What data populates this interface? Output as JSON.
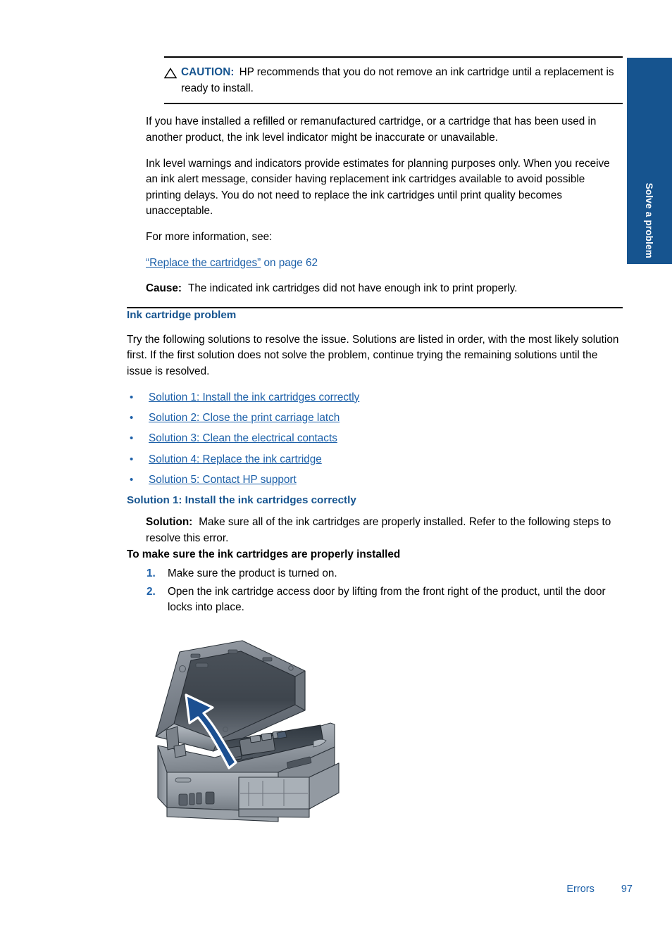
{
  "side_tab": {
    "label": "Solve a problem",
    "color": "#16548F"
  },
  "caution": {
    "icon": "caution-triangle-icon",
    "label": "CAUTION:",
    "text": "HP recommends that you do not remove an ink cartridge until a replacement is ready to install."
  },
  "paragraphs": {
    "refilled": "If you have installed a refilled or remanufactured cartridge, or a cartridge that has been used in another product, the ink level indicator might be inaccurate or unavailable.",
    "ink_level": "Ink level warnings and indicators provide estimates for planning purposes only. When you receive an ink alert message, consider having replacement ink cartridges available to avoid possible printing delays. You do not need to replace the ink cartridges until print quality becomes unacceptable.",
    "more_info": "For more information, see:"
  },
  "crossref": {
    "link_text": "“Replace the cartridges”",
    "suffix": " on page 62"
  },
  "cause": {
    "label": "Cause:",
    "text": "The indicated ink cartridges did not have enough ink to print properly."
  },
  "section": {
    "heading": "Ink cartridge problem",
    "intro": "Try the following solutions to resolve the issue. Solutions are listed in order, with the most likely solution first. If the first solution does not solve the problem, continue trying the remaining solutions until the issue is resolved.",
    "bullet_mark": "•",
    "solutions": [
      "Solution 1: Install the ink cartridges correctly",
      "Solution 2: Close the print carriage latch",
      "Solution 3: Clean the electrical contacts",
      "Solution 4: Replace the ink cartridge",
      "Solution 5: Contact HP support"
    ]
  },
  "solution_1": {
    "heading": "Solution 1: Install the ink cartridges correctly",
    "solution_label": "Solution:",
    "solution_text": "Make sure all of the ink cartridges are properly installed. Refer to the following steps to resolve this error.",
    "steps_title": "To make sure the ink cartridges are properly installed",
    "steps": [
      {
        "num": "1.",
        "text": "Make sure the product is turned on."
      },
      {
        "num": "2.",
        "text": "Open the ink cartridge access door by lifting from the front right of the product, until the door locks into place."
      }
    ],
    "figure_name": "printer-access-door-open-illustration"
  },
  "footer": {
    "chapter": "Errors",
    "page_number": "97"
  },
  "colors": {
    "link": "#1B5FA8",
    "heading": "#16548F",
    "tab": "#16548F",
    "rule": "#000000"
  }
}
